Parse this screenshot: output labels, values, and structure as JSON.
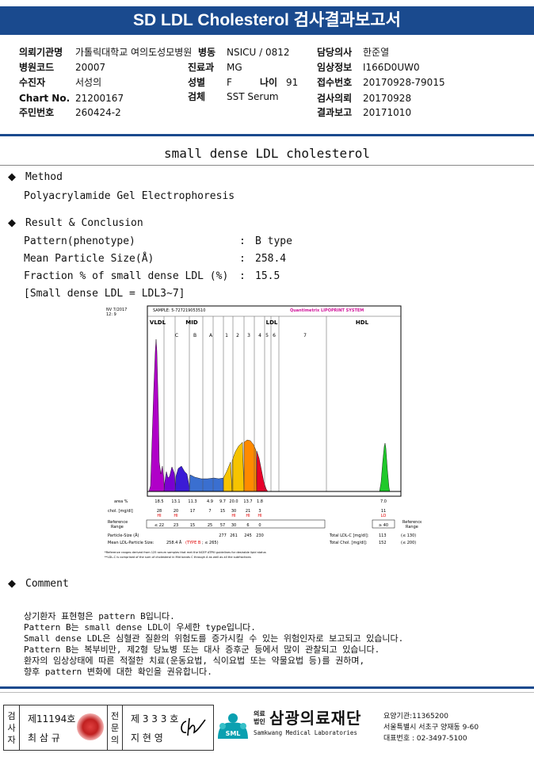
{
  "header": {
    "title": "SD LDL Cholesterol 검사결과보고서"
  },
  "info": {
    "left": [
      {
        "label": "의뢰기관명",
        "value": "가톨릭대학교 여의도성모병원"
      },
      {
        "label": "병원코드",
        "value": "20007"
      },
      {
        "label": "수진자",
        "value": "서성의"
      },
      {
        "label": "Chart No.",
        "value": "21200167"
      },
      {
        "label": "주민번호",
        "value": "260424-2"
      }
    ],
    "mid": [
      {
        "label": "병동",
        "value": "NSICU / 0812"
      },
      {
        "label": "진료과",
        "value": "MG"
      },
      {
        "label": "성별",
        "value": "F"
      },
      {
        "label": "검체",
        "value": "SST Serum"
      }
    ],
    "age": {
      "label": "나이",
      "value": "91"
    },
    "right": [
      {
        "label": "담당의사",
        "value": "한준열"
      },
      {
        "label": "임상정보",
        "value": "I166D0UW0"
      },
      {
        "label": "접수번호",
        "value": "20170928-79015"
      },
      {
        "label": "검사의뢰",
        "value": "20170928"
      },
      {
        "label": "결과보고",
        "value": "20171010"
      }
    ]
  },
  "section_title": "small dense LDL cholesterol",
  "method": {
    "heading": "Method",
    "text": "Polyacrylamide Gel Electrophoresis"
  },
  "result": {
    "heading": "Result & Conclusion",
    "rows": [
      {
        "label": "Pattern(phenotype)",
        "sep": ":",
        "value": "B type"
      },
      {
        "label": "Mean Particle Size(Å)",
        "sep": ":",
        "value": "258.4"
      },
      {
        "label": "Fraction % of small dense LDL (%)",
        "sep": ":",
        "value": "15.5"
      }
    ],
    "note": "[Small dense LDL = LDL3~7]"
  },
  "chart": {
    "date": "NV  7/2017\n12:  9",
    "sample": "SAMPLE:   5-727219053510",
    "brand": "Quantimetrix LIPOPRINT SYSTEM",
    "groups": [
      "VLDL",
      "MID",
      "LDL",
      "HDL"
    ],
    "bands": [
      "C",
      "B",
      "A",
      "1",
      "2",
      "3",
      "4",
      "5",
      "6",
      "7"
    ],
    "area_label": "area %",
    "area_values": [
      "18.5",
      "13.1",
      "11.3",
      "4.9",
      "9.7",
      "20.0",
      "13.7",
      "1.8",
      "7.0"
    ],
    "chol_label": "chol. [mg/dl]",
    "chol_values": [
      "28",
      "20",
      "17",
      "7",
      "15",
      "30",
      "21",
      "3",
      "11"
    ],
    "chol_flags": [
      "HI",
      "HI",
      "",
      "",
      "",
      "HI",
      "HI",
      "HI",
      "LO"
    ],
    "ref_label": "Reference Range",
    "ref_values": [
      "≤ 22",
      "23",
      "15",
      "25",
      "57",
      "30",
      "6",
      "0",
      "≥ 40"
    ],
    "ps_label": "Particle-Size (Å)",
    "ps_values": [
      "277",
      "261",
      "245",
      "230"
    ],
    "mean_label": "Mean LDL-Particle Size:",
    "mean_value": "258.4 Å",
    "mean_type": "(TYPE B",
    "mean_ref": "; ≤ 265)",
    "total_ldl_label": "Total LDL-C [mg/dl]:",
    "total_ldl_value": "113",
    "total_ldl_ref": "(≤ 130)",
    "total_chol_label": "Total Chol. [mg/dl]:",
    "total_chol_value": "152",
    "total_chol_ref": "(≤ 200)",
    "footnote1": "*Reference ranges derived from 125 serum samples that met the NCEP ATPIII guidelines for desirable lipid status",
    "footnote2": "**LDL-C is comprised of the sum of cholesterol in Mid bands C through A as well as all the subfractions",
    "colors": {
      "vldl": "#b000c8",
      "mid_c": "#7a00d0",
      "mid_b": "#3b1bd6",
      "mid_a": "#3a6fd0",
      "ldl1": "#f6c400",
      "ldl2": "#f6c400",
      "ldl3": "#ff8a00",
      "ldl4": "#e8002a",
      "hdl": "#1fc92a"
    }
  },
  "comment": {
    "heading": "Comment",
    "lines": [
      "상기환자 표현형은 pattern B입니다.",
      "Pattern B는 small dense LDL이 우세한 type입니다.",
      "Small dense LDL은 심혈관 질환의 위험도를 증가시킬 수 있는 위험인자로 보고되고 있습니다.",
      "Pattern B는 복부비만, 제2형 당뇨병 또는 대사 증후군 등에서 많이 관찰되고 있습니다.",
      "환자의 임상상태에 따른 적절한 치료(운동요법, 식이요법 또는 약물요법 등)를 권하며,",
      "향후 pattern 변화에 대한 확인을 권유합니다."
    ]
  },
  "footer": {
    "tester_label": "검사자",
    "tester_no": "제11194호",
    "tester_name": "최 삼 규",
    "specialist_label": "전문의",
    "specialist_no": "제 3 3 3 호",
    "specialist_name": "지 현 영",
    "org_small": "의료법인",
    "org_name": "삼광의료재단",
    "org_en": "Samkwang Medical Laboratories",
    "logo_text": "SML",
    "code": "요양기관:11365200",
    "address": "서울특별시 서초구 양재동 9-60",
    "phone": "대표번호 : 02-3497-5100"
  }
}
